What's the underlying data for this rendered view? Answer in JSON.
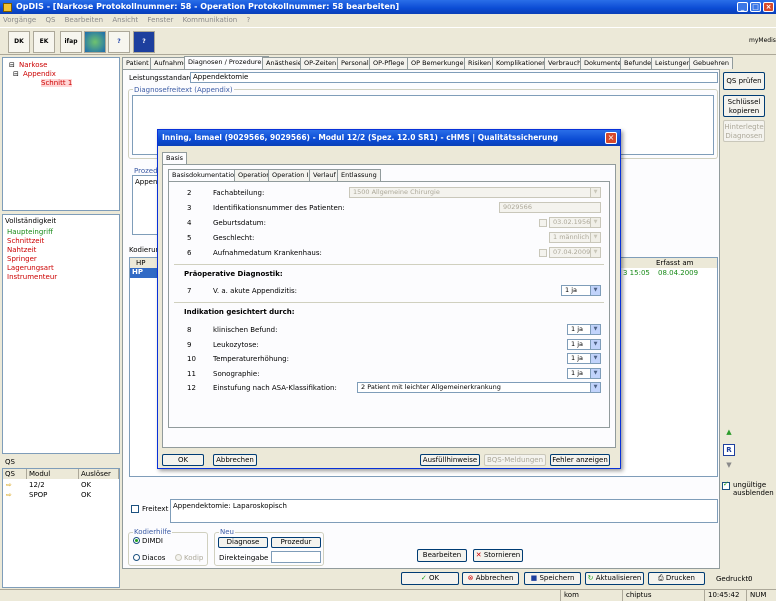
{
  "window": {
    "title": "OpDIS - [Narkose Protokollnummer: 58 - Operation Protokollnummer: 58 bearbeiten]"
  },
  "menu": [
    "Vorgänge",
    "QS",
    "Bearbeiten",
    "Ansicht",
    "Fenster",
    "Kommunikation",
    "?"
  ],
  "toolbar": {
    "btn1": "DK",
    "btn2": "EK",
    "btn3": "ifap",
    "logo": "myMedis"
  },
  "tree": {
    "item1": "Narkose",
    "item2": "Appendix",
    "item3": "Schnitt 1"
  },
  "vollstaendigkeit": {
    "header": "Vollständigkeit",
    "items": [
      "Haupteingriff",
      "Schnittzeit",
      "Nahtzeit",
      "Springer",
      "Lagerungsart",
      "Instrumenteur"
    ]
  },
  "qs": {
    "label": "QS",
    "columns": [
      "QS",
      "Modul",
      "Auslöser"
    ],
    "rows": [
      [
        "12/2",
        "OK"
      ],
      [
        "SPOP",
        "OK"
      ]
    ]
  },
  "tabs": [
    "Patient",
    "Aufnahme",
    "Diagnosen / Prozeduren",
    "Anästhesie",
    "OP-Zeiten",
    "Personal",
    "OP-Pflege",
    "OP Bemerkungen",
    "Risiken",
    "Komplikationen",
    "Verbrauch",
    "Dokumente",
    "Befunde",
    "Leistungen",
    "Gebuehren"
  ],
  "main": {
    "leistungsstandard_label": "Leistungsstandard",
    "leistungsstandard_value": "Appendektomie",
    "diagnose_freitext_label": "Diagnosefreitext (Appendix)",
    "prozed_label": "Prozed",
    "prozed_value": "Appenc",
    "kodierung_label": "Kodierun",
    "hp_col": "HP",
    "hp_val": "HP",
    "time_val": "3 15:05",
    "erfasst_col": "Erfasst am",
    "erfasst_val": "08.04.2009",
    "freitext_label": "Freitext",
    "freitext_value": "Appendektomie: Laparoskopisch",
    "kodierhilfe_label": "Kodierhilfe",
    "dimdi": "DIMDI",
    "diacos": "Diacos",
    "kodip": "Kodip",
    "neu_label": "Neu",
    "diagnose_btn": "Diagnose",
    "prozedur_btn": "Prozedur",
    "direkteingabe": "Direkteingabe",
    "bearbeiten_btn": "Bearbeiten",
    "stornieren_btn": "Stornieren",
    "ungueltige": "ungültige ausblenden"
  },
  "right_buttons": {
    "qs_pruefen": "QS prüfen",
    "schluessel": "Schlüssel kopieren",
    "hinterlegte": "Hinterlegte Diagnosen"
  },
  "bottom": {
    "ok": "OK",
    "abbrechen": "Abbrechen",
    "speichern": "Speichern",
    "aktualisieren": "Aktualisieren",
    "drucken": "Drucken",
    "gedruckt_label": "Gedruckt:",
    "gedruckt_val": "0"
  },
  "status": {
    "kom": "kom",
    "user": "chiptus",
    "time": "10:45:42",
    "num": "NUM"
  },
  "dialog": {
    "title": "Inning, Ismael (9029566, 9029566) - Modul 12/2 (Spez. 12.0 SR1) - cHMS | Qualitätssicherung",
    "top_tab": "Basis",
    "subtabs": [
      "Basisdokumentation",
      "Operation",
      "Operation II",
      "Verlauf",
      "Entlassung"
    ],
    "rows": [
      {
        "n": "2",
        "label": "Fachabteilung:",
        "value": "1500  Allgemeine Chirurgie"
      },
      {
        "n": "3",
        "label": "Identifikationsnummer des Patienten:",
        "value": "9029566"
      },
      {
        "n": "4",
        "label": "Geburtsdatum:",
        "value": "03.02.1956"
      },
      {
        "n": "5",
        "label": "Geschlecht:",
        "value": "1   männlich"
      },
      {
        "n": "6",
        "label": "Aufnahmedatum Krankenhaus:",
        "value": "07.04.2009"
      }
    ],
    "section1": "Präoperative Diagnostik:",
    "row7": {
      "n": "7",
      "label": "V. a. akute Appendizitis:",
      "value": "1   ja"
    },
    "section2": "Indikation gesichtert durch:",
    "rows2": [
      {
        "n": "8",
        "label": "klinischen Befund:",
        "value": "1   ja"
      },
      {
        "n": "9",
        "label": "Leukozytose:",
        "value": "1   ja"
      },
      {
        "n": "10",
        "label": "Temperaturerhöhung:",
        "value": "1   ja"
      },
      {
        "n": "11",
        "label": "Sonographie:",
        "value": "1   ja"
      },
      {
        "n": "12",
        "label": "Einstufung nach ASA-Klassifikation:",
        "value": "2   Patient mit leichter Allgemeinerkrankung"
      }
    ],
    "ok": "OK",
    "abbrechen": "Abbrechen",
    "ausfuell": "Ausfüllhinweise",
    "bqs": "BQS-Meldungen",
    "fehler": "Fehler anzeigen"
  }
}
